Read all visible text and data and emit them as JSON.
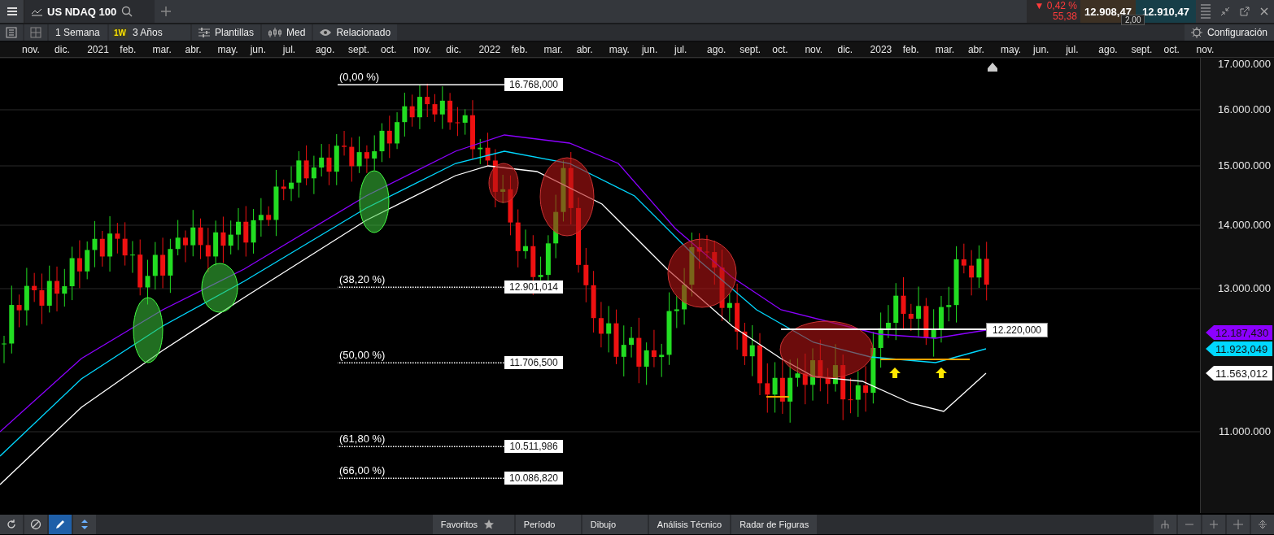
{
  "header": {
    "tab_title": "US NDAQ 100",
    "change": "▼ 0,42 %",
    "change_points": "55,38",
    "sell": "12.908,47",
    "buy": "12.910,47",
    "spread": "2,00"
  },
  "toolbar": {
    "interval": "1 Semana",
    "interval_badge": "1W",
    "range": "3 Años",
    "templates": "Plantillas",
    "chart_type": "Med",
    "related": "Relacionado",
    "settings": "Configuración"
  },
  "chart": {
    "months": [
      "nov.",
      "dic.",
      "2021",
      "feb.",
      "mar.",
      "abr.",
      "may.",
      "jun.",
      "jul.",
      "ago.",
      "sept.",
      "oct.",
      "nov.",
      "dic.",
      "2022",
      "feb.",
      "mar.",
      "abr.",
      "may.",
      "jun.",
      "jul.",
      "ago.",
      "sept.",
      "oct.",
      "nov.",
      "dic.",
      "2023",
      "feb.",
      "mar.",
      "abr.",
      "may.",
      "jun.",
      "jul.",
      "ago.",
      "sept.",
      "oct.",
      "nov."
    ],
    "price_axis": [
      "17.000.000",
      "16.000.000",
      "15.000.000",
      "14.000.000",
      "13.000.000",
      "11.000.000"
    ],
    "fibonacci": [
      {
        "label": "(0,00 %)",
        "value": "16.768,000",
        "dotted": false
      },
      {
        "label": "(38,20 %)",
        "value": "12.901,014",
        "dotted": true
      },
      {
        "label": "(50,00 %)",
        "value": "11.706,500",
        "dotted": true
      },
      {
        "label": "(61,80 %)",
        "value": "10.511,986",
        "dotted": true
      },
      {
        "label": "(66,00 %)",
        "value": "10.086,820",
        "dotted": true
      }
    ],
    "level_line": "12.220,000",
    "indicators": [
      {
        "value": "12.187,430",
        "color": "#8c00ff"
      },
      {
        "value": "11.923,049",
        "color": "#00d8ff"
      },
      {
        "value": "11.563,012",
        "color": "#ffffff"
      }
    ]
  },
  "bottom_bar": {
    "tools": [
      {
        "selected": false
      },
      {
        "selected": false
      },
      {
        "selected": true
      },
      {
        "selected": false
      }
    ],
    "tabs": [
      "Favoritos",
      "Período",
      "Dibujo",
      "Análisis Técnico",
      "Radar de Figuras"
    ]
  }
}
